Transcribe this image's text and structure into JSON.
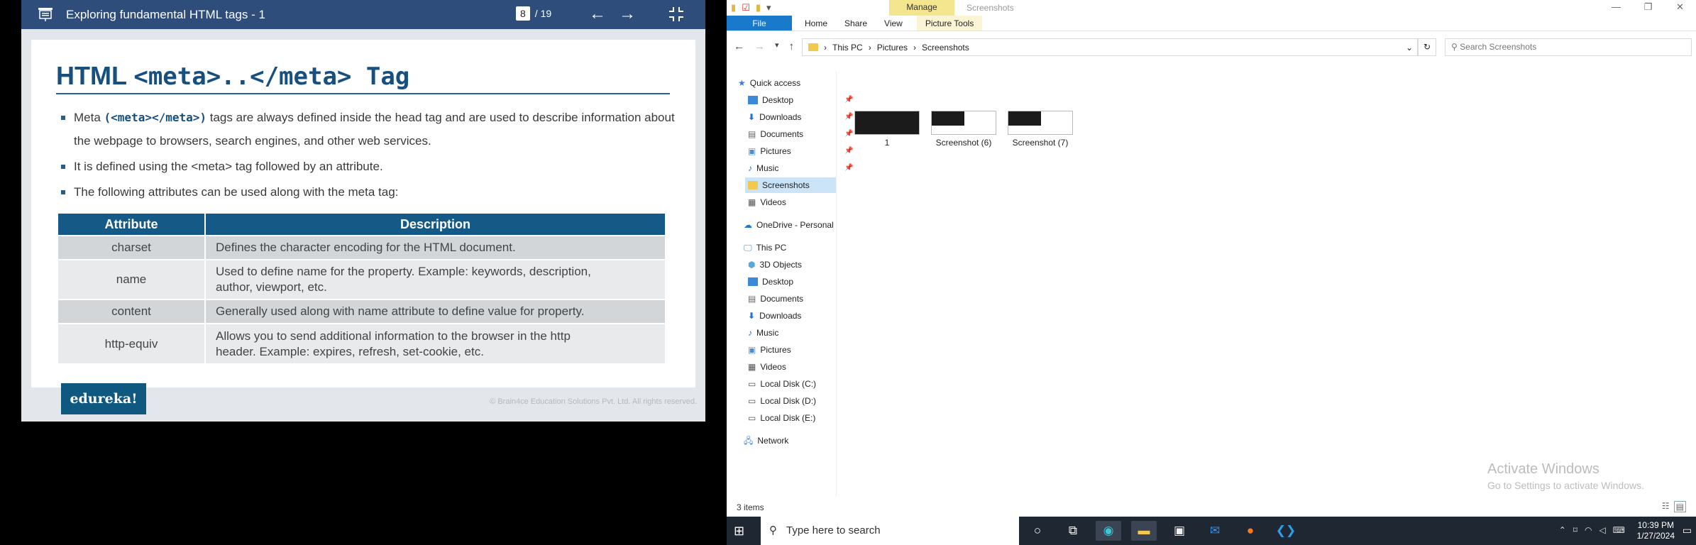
{
  "viewer": {
    "title": "Exploring fundamental HTML tags - 1",
    "page_current": "8",
    "page_total": "/ 19"
  },
  "slide": {
    "heading_html": "HTML",
    "heading_code": "<meta>..</meta> Tag",
    "bullets": [
      {
        "prefix": "Meta ",
        "code": "(<meta></meta>)",
        "text": " tags are always defined inside the head tag and are used to describe information about the webpage to browsers, search engines, and other web services."
      },
      {
        "prefix": "",
        "code": "",
        "text": "It is defined using the <meta> tag followed by an attribute."
      },
      {
        "prefix": "",
        "code": "",
        "text": "The following attributes can be used along with the meta tag:"
      }
    ],
    "table": {
      "headers": [
        "Attribute",
        "Description"
      ],
      "rows": [
        {
          "attr": "charset",
          "desc": "Defines the character encoding for the HTML document."
        },
        {
          "attr": "name",
          "desc": "Used to define name for the property. Example: keywords, description, author, viewport, etc."
        },
        {
          "attr": "content",
          "desc": "Generally used along with name attribute to define value for property."
        },
        {
          "attr": "http-equiv",
          "desc": "Allows you to send additional information to the browser in the http header. Example: expires, refresh, set-cookie, etc."
        }
      ]
    },
    "logo": "edureka!",
    "copyright": "© Brain4ce Education Solutions Pvt. Ltd. All rights reserved."
  },
  "explorer": {
    "manage_label": "Manage",
    "window_title": "Screenshots",
    "tabs": [
      "File",
      "Home",
      "Share",
      "View",
      "Picture Tools"
    ],
    "breadcrumb": [
      "This PC",
      "Pictures",
      "Screenshots"
    ],
    "search_placeholder": "Search Screenshots",
    "nav": {
      "quick_access": "Quick access",
      "quick_items": [
        "Desktop",
        "Downloads",
        "Documents",
        "Pictures",
        "Music",
        "Screenshots",
        "Videos"
      ],
      "onedrive": "OneDrive - Personal",
      "this_pc": "This PC",
      "pc_items": [
        "3D Objects",
        "Desktop",
        "Documents",
        "Downloads",
        "Music",
        "Pictures",
        "Videos",
        "Local Disk (C:)",
        "Local Disk (D:)",
        "Local Disk (E:)"
      ],
      "network": "Network"
    },
    "files": [
      "1",
      "Screenshot (6)",
      "Screenshot (7)"
    ],
    "status": "3 items",
    "watermark_title": "Activate Windows",
    "watermark_sub": "Go to Settings to activate Windows."
  },
  "taskbar": {
    "search": "Type here to search",
    "time": "10:39 PM",
    "date": "1/27/2024"
  }
}
